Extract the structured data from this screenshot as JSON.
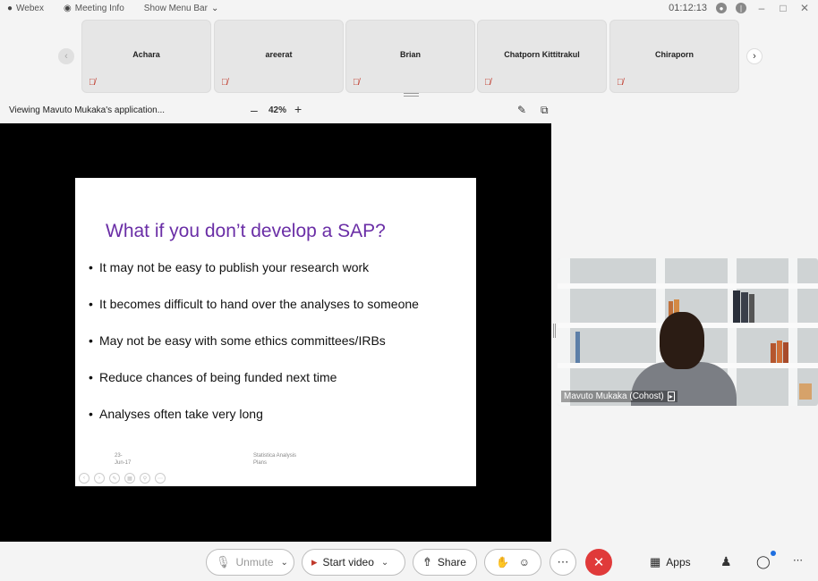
{
  "window": {
    "app_name": "Webex",
    "meeting_info": "Meeting Info",
    "show_menu_bar": "Show Menu Bar",
    "timer": "01:12:13"
  },
  "participants": [
    {
      "name": "Achara"
    },
    {
      "name": "areerat"
    },
    {
      "name": "Brian"
    },
    {
      "name": "Chatporn Kittitrakul"
    },
    {
      "name": "Chiraporn"
    }
  ],
  "share": {
    "viewing_label": "Viewing Mavuto Mukaka's application...",
    "zoom_level": "42%"
  },
  "slide": {
    "title": "What if you don’t develop a SAP?",
    "bullets": [
      "It may not be easy to publish your research work",
      "It becomes difficult to hand over the analyses to  someone",
      "May not be easy with some ethics committees/IRBs",
      "Reduce chances of being funded next time",
      "Analyses often take very long"
    ],
    "date": "23-Jun-17",
    "footer": "Statistica Analysis Plans"
  },
  "speaker": {
    "label": "Mavuto Mukaka (Cohost)"
  },
  "toolbar": {
    "unmute_label": "Unmute",
    "start_video_label": "Start video",
    "share_label": "Share",
    "apps_label": "Apps"
  },
  "colors": {
    "slide_title": "#6a2ea6",
    "end_call": "#e03a3a",
    "notification": "#1e6fe0"
  }
}
